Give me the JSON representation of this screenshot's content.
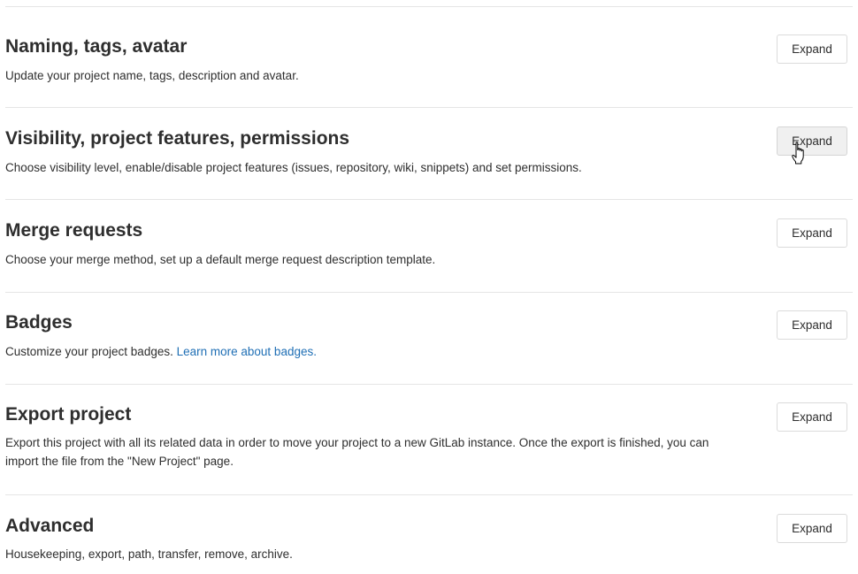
{
  "sections": [
    {
      "title": "Naming, tags, avatar",
      "description": "Update your project name, tags, description and avatar.",
      "button_label": "Expand"
    },
    {
      "title": "Visibility, project features, permissions",
      "description": "Choose visibility level, enable/disable project features (issues, repository, wiki, snippets) and set permissions.",
      "button_label": "Expand"
    },
    {
      "title": "Merge requests",
      "description": "Choose your merge method, set up a default merge request description template.",
      "button_label": "Expand"
    },
    {
      "title": "Badges",
      "description": "Customize your project badges.",
      "link_text": "Learn more about badges.",
      "button_label": "Expand"
    },
    {
      "title": "Export project",
      "description": "Export this project with all its related data in order to move your project to a new GitLab instance. Once the export is finished, you can import the file from the \"New Project\" page.",
      "button_label": "Expand"
    },
    {
      "title": "Advanced",
      "description": "Housekeeping, export, path, transfer, remove, archive.",
      "button_label": "Expand"
    }
  ],
  "colors": {
    "link": "#1f6fb5",
    "divider": "#e5e5e5",
    "text": "#2e2e2e"
  }
}
